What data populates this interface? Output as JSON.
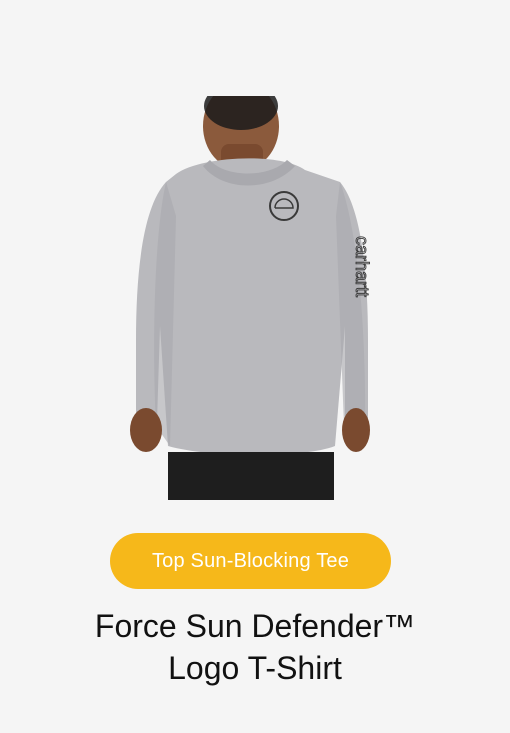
{
  "badge": {
    "label": "Top Sun-Blocking Tee",
    "color": "#f6b81a"
  },
  "product": {
    "title_line1": "Force Sun Defender™",
    "title_line2": "Logo T-Shirt",
    "image_icon": "tshirt-product-photo",
    "sleeve_text": "carhartt"
  }
}
